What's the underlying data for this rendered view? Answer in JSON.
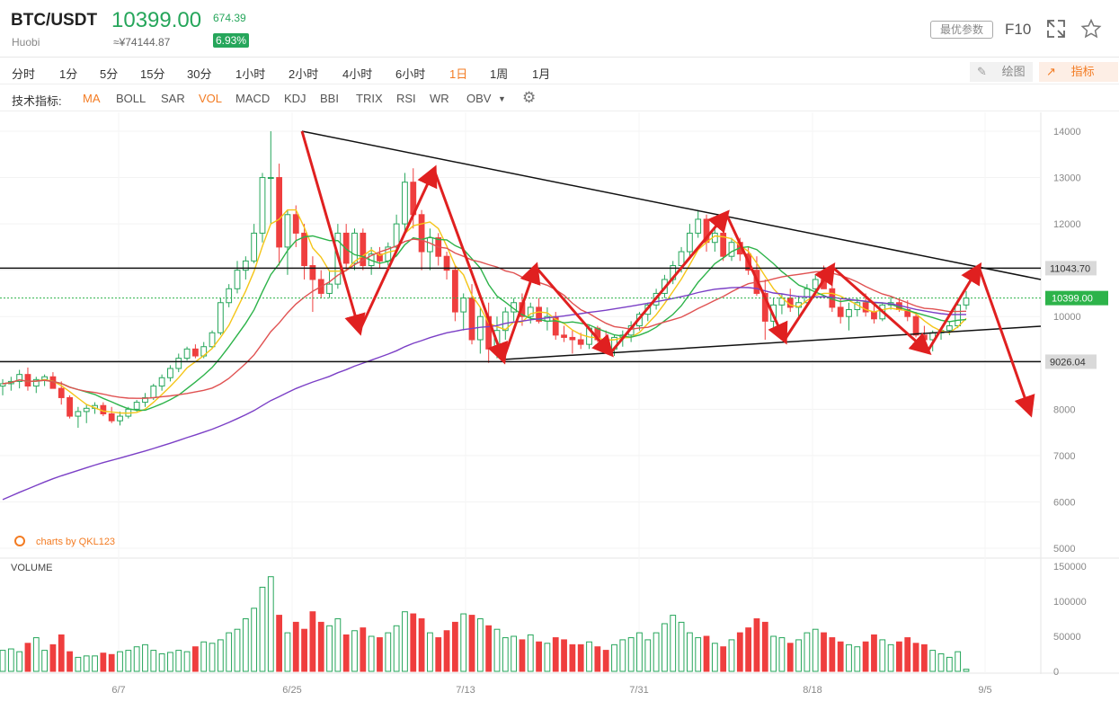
{
  "header": {
    "symbol": "BTC/USDT",
    "exchange": "Huobi",
    "price": "10399.00",
    "cny": "≈¥74144.87",
    "change": "674.39",
    "change_pct": "6.93%",
    "best_params": "最优参数",
    "f10": "F10"
  },
  "timeframes": [
    "分时",
    "1分",
    "5分",
    "15分",
    "30分",
    "1小时",
    "2小时",
    "4小时",
    "6小时",
    "1日",
    "1周",
    "1月"
  ],
  "active_timeframe": "1日",
  "tools": {
    "draw": "绘图",
    "indicator": "指标"
  },
  "indicator_label": "技术指标:",
  "indicators": [
    "MA",
    "BOLL",
    "SAR",
    "VOL",
    "MACD",
    "KDJ",
    "BBI",
    "TRIX",
    "RSI",
    "WR",
    "OBV"
  ],
  "active_indicators": [
    "MA",
    "VOL"
  ],
  "colors": {
    "up": "#26a65b",
    "down": "#ef3e3e",
    "accent": "#f37b22"
  },
  "chart_data": {
    "type": "candlestick",
    "y_ticks": [
      "14000",
      "13000",
      "12000",
      "11000",
      "10000",
      "9000",
      "8000",
      "7000",
      "6000",
      "5000"
    ],
    "x_ticks": [
      "6/7",
      "6/25",
      "7/13",
      "7/31",
      "8/18",
      "9/5"
    ],
    "ylim": [
      5000,
      14000
    ],
    "price_tags": {
      "resistance": "11043.70",
      "current": "10399.00",
      "support": "9026.04"
    },
    "watermark": "charts by QKL123",
    "volume_label": "VOLUME",
    "volume_ticks": [
      "150000",
      "100000",
      "50000",
      "0"
    ],
    "candles": [
      [
        8500,
        8650,
        8300,
        8550
      ],
      [
        8550,
        8700,
        8400,
        8600
      ],
      [
        8600,
        8850,
        8450,
        8750
      ],
      [
        8750,
        8900,
        8400,
        8500
      ],
      [
        8500,
        8700,
        8350,
        8640
      ],
      [
        8640,
        8750,
        8500,
        8700
      ],
      [
        8700,
        8800,
        8550,
        8450
      ],
      [
        8450,
        8600,
        8100,
        8250
      ],
      [
        8250,
        8300,
        7800,
        7850
      ],
      [
        7850,
        8050,
        7600,
        7950
      ],
      [
        7950,
        8100,
        7700,
        8020
      ],
      [
        8020,
        8150,
        7900,
        8080
      ],
      [
        8080,
        8150,
        7850,
        7900
      ],
      [
        7900,
        8050,
        7700,
        7750
      ],
      [
        7750,
        7950,
        7650,
        7850
      ],
      [
        7850,
        8050,
        7800,
        8000
      ],
      [
        8000,
        8200,
        7950,
        8150
      ],
      [
        8150,
        8350,
        8050,
        8250
      ],
      [
        8250,
        8550,
        8200,
        8500
      ],
      [
        8500,
        8750,
        8400,
        8680
      ],
      [
        8680,
        8950,
        8600,
        8880
      ],
      [
        8880,
        9200,
        8800,
        9100
      ],
      [
        9100,
        9350,
        9050,
        9300
      ],
      [
        9300,
        9400,
        9100,
        9150
      ],
      [
        9150,
        9450,
        9100,
        9350
      ],
      [
        9350,
        9700,
        9300,
        9650
      ],
      [
        9650,
        10400,
        9600,
        10300
      ],
      [
        10300,
        10700,
        10200,
        10600
      ],
      [
        10600,
        11200,
        10500,
        11000
      ],
      [
        11000,
        11300,
        10800,
        11200
      ],
      [
        11200,
        12000,
        11150,
        11800
      ],
      [
        11800,
        13100,
        11600,
        13000
      ],
      [
        13000,
        14000,
        12000,
        13000
      ],
      [
        13000,
        13300,
        11100,
        11500
      ],
      [
        11500,
        12300,
        10900,
        12200
      ],
      [
        12200,
        12400,
        11500,
        11800
      ],
      [
        11800,
        12000,
        10800,
        11100
      ],
      [
        11100,
        11300,
        10100,
        10800
      ],
      [
        10800,
        11000,
        10400,
        10500
      ],
      [
        10500,
        11000,
        10400,
        10700
      ],
      [
        10700,
        12000,
        10600,
        11800
      ],
      [
        11800,
        12000,
        11000,
        11150
      ],
      [
        11150,
        11900,
        11000,
        11800
      ],
      [
        11800,
        11900,
        11000,
        11100
      ],
      [
        11100,
        11500,
        10900,
        11350
      ],
      [
        11350,
        11500,
        11050,
        11200
      ],
      [
        11200,
        11600,
        11100,
        11500
      ],
      [
        11500,
        12200,
        11400,
        12000
      ],
      [
        12000,
        13100,
        11800,
        12900
      ],
      [
        12900,
        13200,
        11900,
        12200
      ],
      [
        12200,
        12300,
        11000,
        11400
      ],
      [
        11400,
        11900,
        11000,
        11700
      ],
      [
        11700,
        11800,
        11100,
        11300
      ],
      [
        11300,
        11400,
        10800,
        11000
      ],
      [
        11000,
        11100,
        9900,
        10100
      ],
      [
        10100,
        10500,
        9700,
        10400
      ],
      [
        10400,
        10700,
        9400,
        9500
      ],
      [
        9500,
        10200,
        9200,
        10000
      ],
      [
        10000,
        10300,
        9000,
        9300
      ],
      [
        9300,
        10000,
        9100,
        9700
      ],
      [
        9700,
        10200,
        9500,
        10100
      ],
      [
        10100,
        10400,
        9900,
        10300
      ],
      [
        10300,
        10500,
        9800,
        10000
      ],
      [
        10000,
        10300,
        9850,
        10200
      ],
      [
        10200,
        10400,
        9850,
        9900
      ],
      [
        9900,
        10200,
        9700,
        10000
      ],
      [
        10000,
        10100,
        9500,
        9600
      ],
      [
        9600,
        9800,
        9450,
        9550
      ],
      [
        9550,
        9700,
        9200,
        9500
      ],
      [
        9500,
        9650,
        9300,
        9400
      ],
      [
        9400,
        9800,
        9300,
        9750
      ],
      [
        9750,
        9800,
        9450,
        9500
      ],
      [
        9500,
        9700,
        9250,
        9300
      ],
      [
        9300,
        9600,
        9150,
        9550
      ],
      [
        9550,
        9700,
        9350,
        9600
      ],
      [
        9600,
        9900,
        9450,
        9800
      ],
      [
        9800,
        10100,
        9700,
        10050
      ],
      [
        10050,
        10300,
        9900,
        10250
      ],
      [
        10250,
        10600,
        10150,
        10500
      ],
      [
        10500,
        10900,
        10400,
        10800
      ],
      [
        10800,
        11200,
        10700,
        11100
      ],
      [
        11100,
        11500,
        10950,
        11400
      ],
      [
        11400,
        12000,
        11300,
        11800
      ],
      [
        11800,
        12300,
        11700,
        12100
      ],
      [
        12100,
        12200,
        11400,
        11600
      ],
      [
        11600,
        11900,
        11400,
        11800
      ],
      [
        11800,
        12000,
        11200,
        11300
      ],
      [
        11300,
        11700,
        11200,
        11600
      ],
      [
        11600,
        11700,
        11200,
        11350
      ],
      [
        11350,
        11500,
        10900,
        11000
      ],
      [
        11000,
        11300,
        10450,
        10500
      ],
      [
        10500,
        10800,
        9500,
        9900
      ],
      [
        9900,
        10400,
        9700,
        10250
      ],
      [
        10250,
        10500,
        10050,
        10400
      ],
      [
        10400,
        10600,
        10100,
        10200
      ],
      [
        10200,
        10450,
        9950,
        10300
      ],
      [
        10300,
        10700,
        10200,
        10600
      ],
      [
        10600,
        10900,
        10500,
        10800
      ],
      [
        10800,
        11100,
        10600,
        10600
      ],
      [
        10600,
        10800,
        10100,
        10200
      ],
      [
        10200,
        10400,
        9850,
        10000
      ],
      [
        10000,
        10300,
        9700,
        10150
      ],
      [
        10150,
        10400,
        10000,
        10300
      ],
      [
        10300,
        10500,
        10000,
        10100
      ],
      [
        10100,
        10300,
        9850,
        9950
      ],
      [
        9950,
        10300,
        9900,
        10250
      ],
      [
        10250,
        10450,
        10150,
        10300
      ],
      [
        10300,
        10400,
        10100,
        10150
      ],
      [
        10150,
        10350,
        9900,
        10000
      ],
      [
        10000,
        10100,
        9550,
        9600
      ],
      [
        9600,
        9800,
        9400,
        9500
      ],
      [
        9500,
        9700,
        9250,
        9650
      ],
      [
        9650,
        9750,
        9500,
        9700
      ],
      [
        9700,
        9900,
        9600,
        9800
      ],
      [
        9800,
        10300,
        9750,
        10250
      ],
      [
        10250,
        10550,
        10150,
        10399
      ]
    ],
    "volumes": [
      30,
      32,
      28,
      40,
      48,
      30,
      38,
      52,
      28,
      20,
      22,
      22,
      26,
      24,
      28,
      30,
      35,
      38,
      30,
      25,
      27,
      30,
      28,
      35,
      42,
      40,
      45,
      55,
      60,
      75,
      90,
      120,
      135,
      80,
      55,
      70,
      60,
      85,
      70,
      65,
      75,
      52,
      58,
      62,
      50,
      48,
      55,
      65,
      85,
      82,
      75,
      55,
      48,
      58,
      70,
      82,
      80,
      75,
      65,
      60,
      48,
      50,
      45,
      52,
      42,
      40,
      48,
      45,
      38,
      38,
      42,
      35,
      30,
      38,
      45,
      48,
      55,
      45,
      55,
      68,
      80,
      70,
      55,
      48,
      50,
      40,
      35,
      45,
      55,
      62,
      75,
      70,
      50,
      48,
      40,
      45,
      55,
      60,
      55,
      48,
      42,
      38,
      35,
      42,
      52,
      45,
      38,
      42,
      48,
      40,
      38,
      30,
      25,
      20,
      28,
      3
    ]
  }
}
